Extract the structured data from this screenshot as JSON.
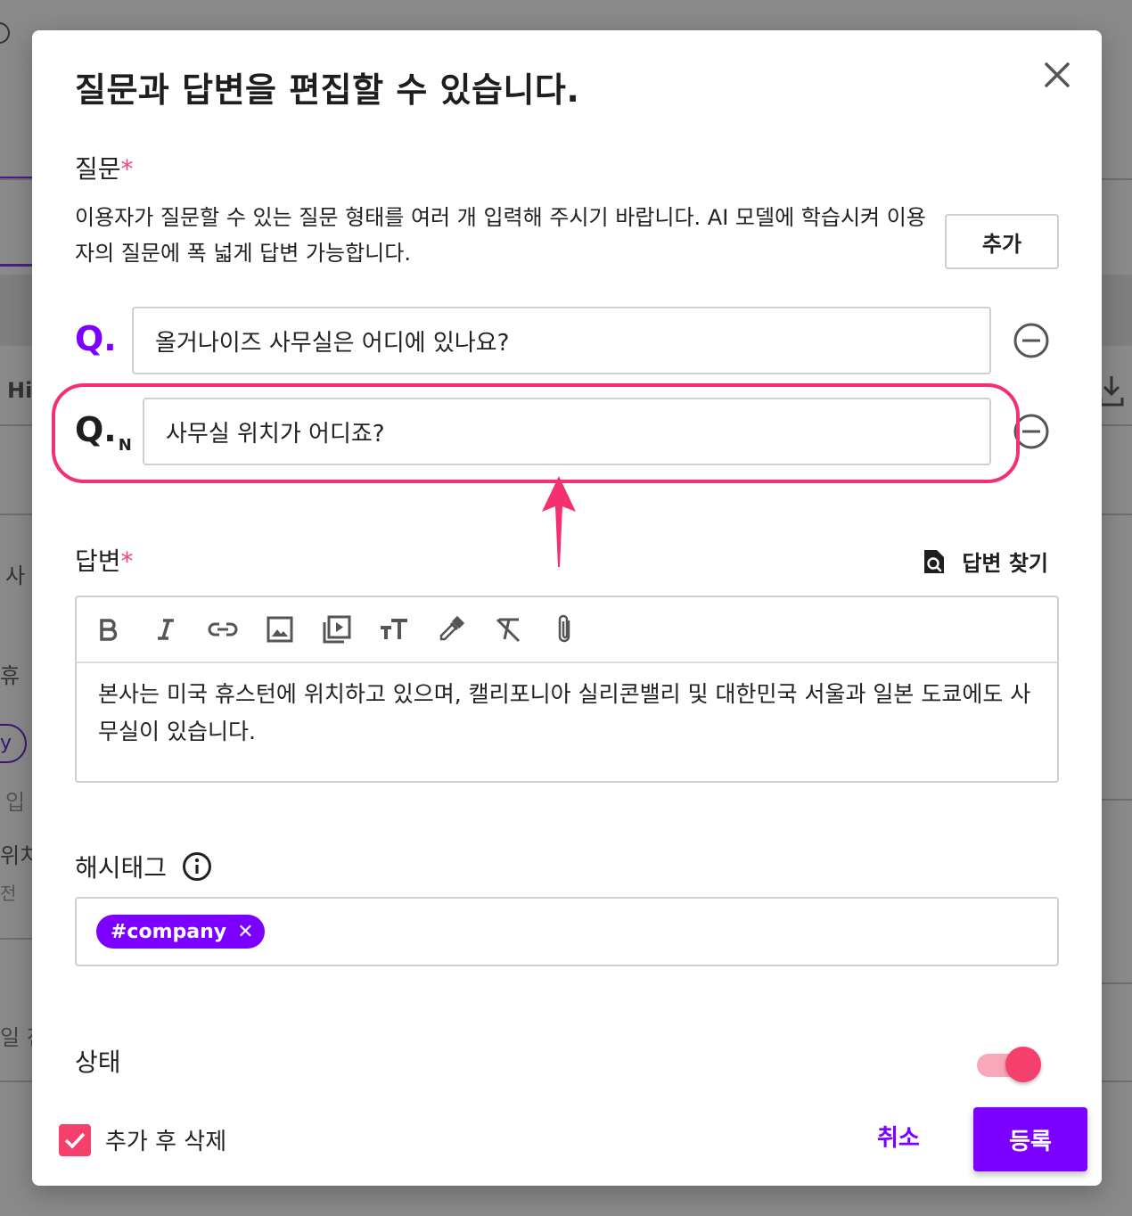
{
  "background": {
    "fragments": [
      "Hi",
      "사",
      "휴",
      "y",
      "입",
      "위치",
      "전",
      "일 전"
    ]
  },
  "dialog": {
    "title": "질문과 답변을 편집할 수 있습니다.",
    "close_icon": "close-icon"
  },
  "question_section": {
    "label": "질문",
    "required_mark": "*",
    "description": "이용자가 질문할 수 있는 질문 형태를 여러 개 입력해 주시기 바랍니다. AI 모델에 학습시켜 이용자의 질문에 폭 넓게 답변 가능합니다.",
    "add_label": "추가",
    "questions": [
      {
        "prefix": "Q.",
        "suffix": "",
        "value": "올거나이즈 사무실은 어디에 있나요?"
      },
      {
        "prefix": "Q.",
        "suffix": "N",
        "value": "사무실 위치가 어디죠?"
      }
    ]
  },
  "answer_section": {
    "label": "답변",
    "required_mark": "*",
    "find_label": "답변 찾기",
    "toolbar": [
      "bold-icon",
      "italic-icon",
      "link-icon",
      "image-icon",
      "video-icon",
      "text-size-icon",
      "color-picker-icon",
      "clear-format-icon",
      "attachment-icon"
    ],
    "body": "본사는 미국 휴스턴에 위치하고 있으며, 캘리포니아 실리콘밸리 및 대한민국 서울과 일본 도쿄에도 사무실이 있습니다."
  },
  "hashtag_section": {
    "label": "해시태그",
    "tags": [
      "#company"
    ]
  },
  "status_section": {
    "label": "상태",
    "enabled": true
  },
  "footer": {
    "checkbox_label": "추가 후 삭제",
    "checkbox_checked": true,
    "cancel_label": "취소",
    "submit_label": "등록"
  },
  "colors": {
    "accent": "#7b00ff",
    "highlight": "#f5306f",
    "required": "#f0457a"
  }
}
